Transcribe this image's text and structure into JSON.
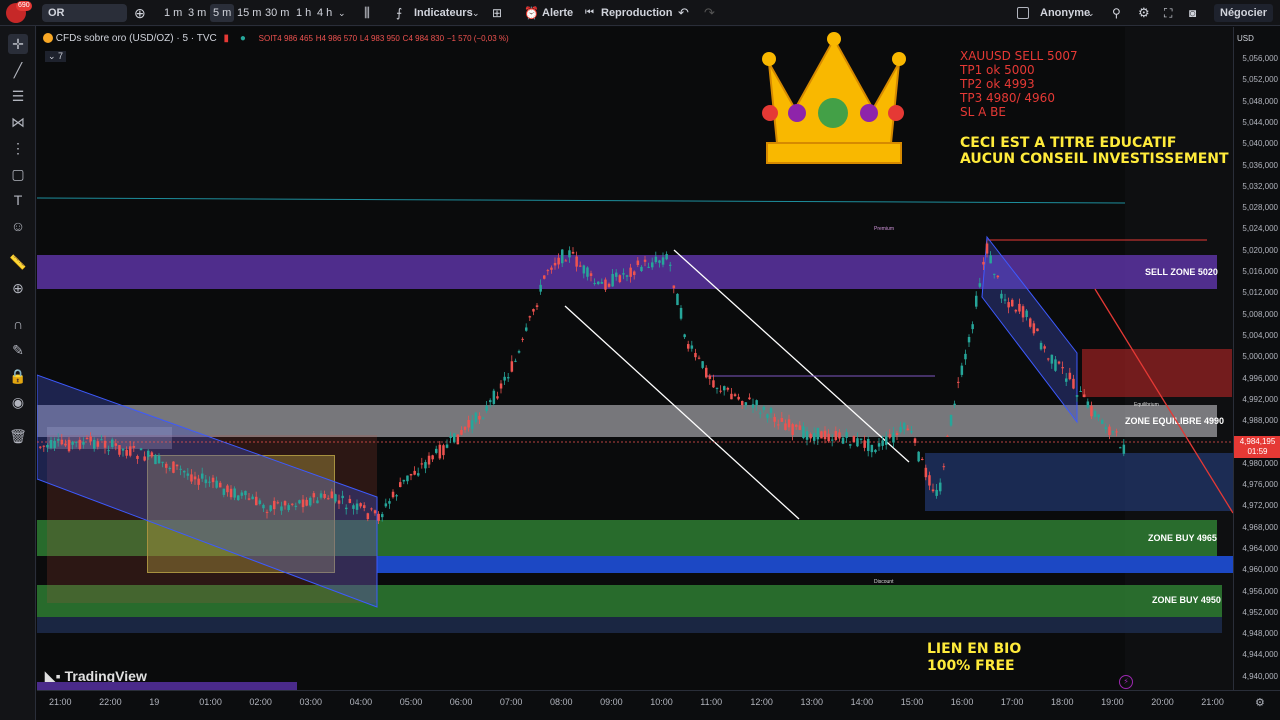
{
  "topbar": {
    "avatar_badge": "690",
    "symbol": "OR",
    "timeframes": [
      "1 m",
      "3 m",
      "5 m",
      "15 m",
      "30 m",
      "1 h",
      "4 h"
    ],
    "active_timeframe": "5 m",
    "indicators": "Indicateurs",
    "alert": "Alerte",
    "replay": "Reproduction",
    "layout_name": "Anonyme",
    "trade": "Négocier"
  },
  "legend": {
    "title": "CFDs sobre oro (USD/OZ) · 5 · TVC",
    "o": "SOIT4 986 465",
    "h": "H4 986 570",
    "l": "L4 983 950",
    "c": "C4 984 830",
    "chg": "−1 570 (−0,03 %)",
    "collapsed_count": "7"
  },
  "currency": "USD",
  "price_ticks": [
    "5,056,000",
    "5,052,000",
    "5,048,000",
    "5,044,000",
    "5,040,000",
    "5,036,000",
    "5,032,000",
    "5,028,000",
    "5,024,000",
    "5,020,000",
    "5,016,000",
    "5,012,000",
    "5,008,000",
    "5,004,000",
    "5,000,000",
    "4,996,000",
    "4,992,000",
    "4,988,000",
    "4,984,000",
    "4,980,000",
    "4,976,000",
    "4,972,000",
    "4,968,000",
    "4,964,000",
    "4,960,000",
    "4,956,000",
    "4,952,000",
    "4,948,000",
    "4,944,000",
    "4,940,000"
  ],
  "last_price": {
    "value": "4,984,195",
    "countdown": "01:59"
  },
  "time_ticks": [
    "21:00",
    "22:00",
    "19",
    "01:00",
    "02:00",
    "03:00",
    "04:00",
    "05:00",
    "06:00",
    "07:00",
    "08:00",
    "09:00",
    "10:00",
    "11:00",
    "12:00",
    "13:00",
    "14:00",
    "15:00",
    "16:00",
    "17:00",
    "18:00",
    "19:00",
    "20:00",
    "21:00"
  ],
  "zones": {
    "sell": "SELL ZONE 5020",
    "equilibre": "ZONE EQUILIBRE 4990",
    "buy1": "ZONE BUY 4965",
    "buy2": "ZONE BUY 4950",
    "premium": "Premium",
    "discount": "Discount",
    "equilibrium": "Equilibrium"
  },
  "signal": {
    "line1": "XAUUSD SELL 5007",
    "line2": "TP1 ok 5000",
    "line3": "TP2 ok 4993",
    "line4": "TP3 4980/ 4960",
    "line5": "SL A BE"
  },
  "disclaimer": {
    "line1": "CECI EST A TITRE EDUCATIF",
    "line2": "AUCUN CONSEIL INVESTISSEMENT"
  },
  "promo": {
    "line1": "LIEN EN BIO",
    "line2": "100% FREE"
  },
  "watermark": "TradingView",
  "colors": {
    "up": "#26a69a",
    "down": "#ef5350",
    "sell_zone": "#5b2a9e",
    "buy_zone": "#2e7d32",
    "blue_zone": "#1e4fd8",
    "signal_red": "#e53935",
    "disclaimer_yellow": "#ffeb3b"
  }
}
